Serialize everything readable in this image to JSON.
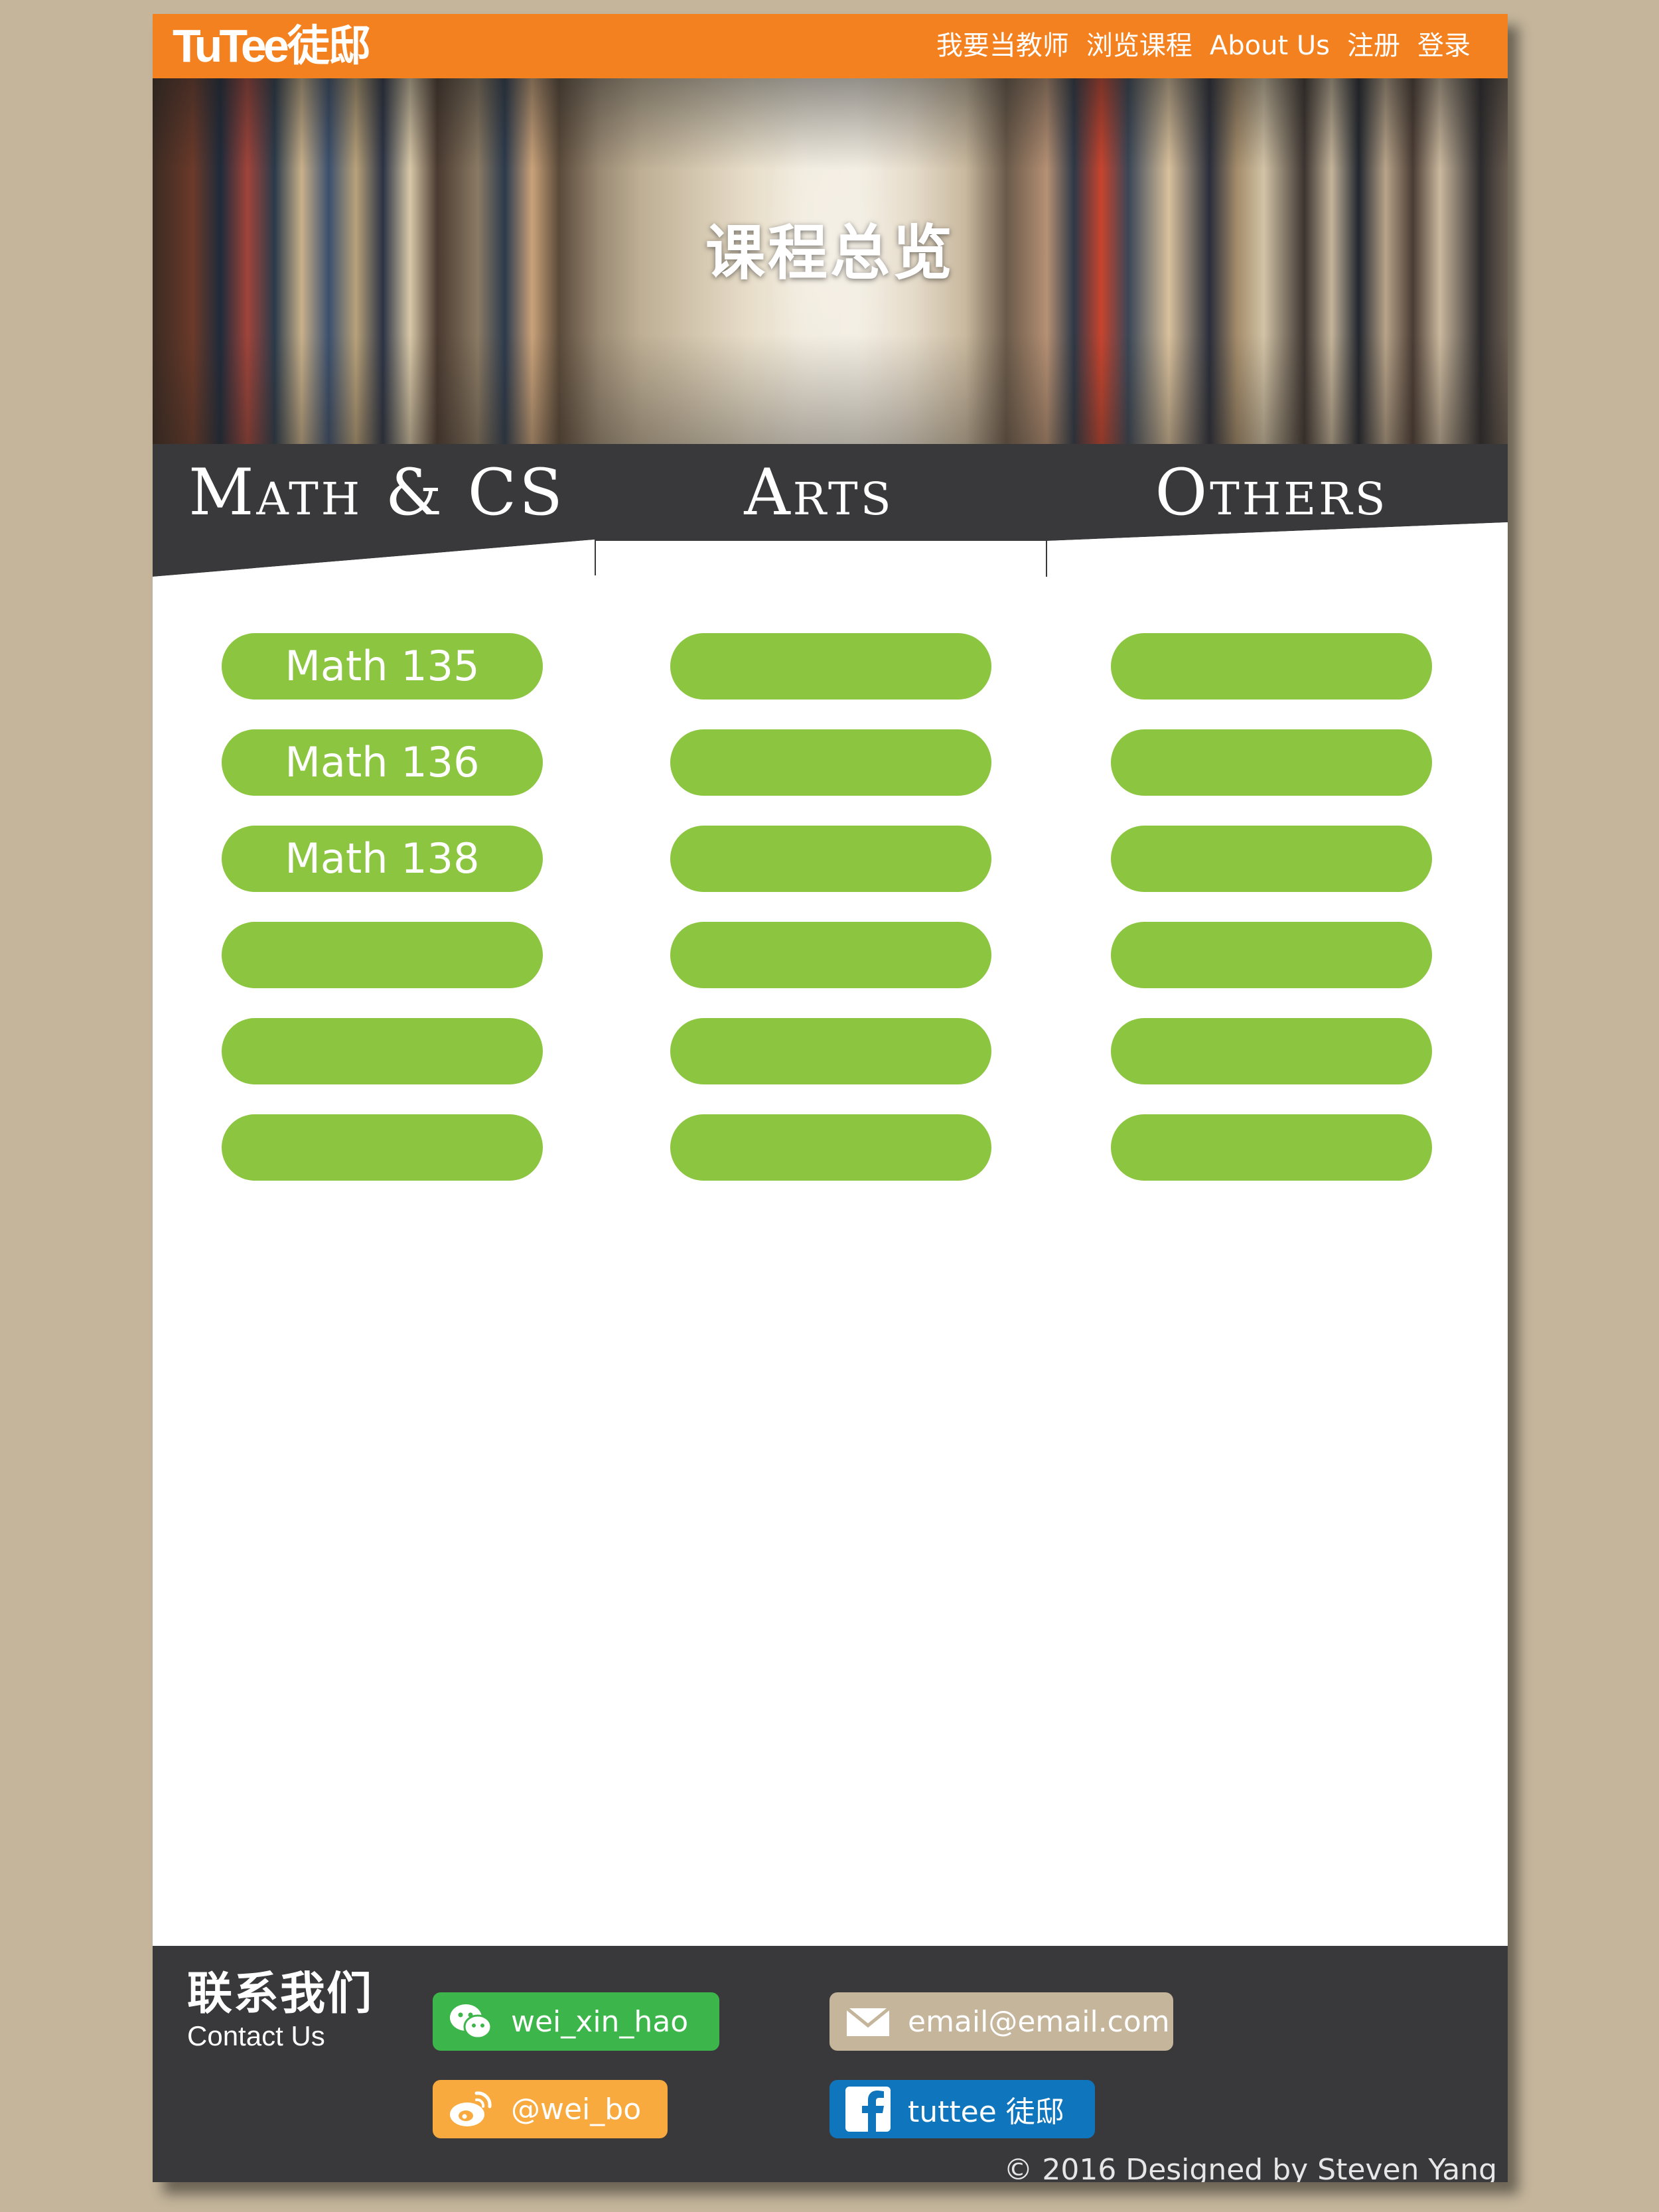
{
  "header": {
    "logo_latin": "TuTee",
    "logo_cn": "徒邸",
    "nav": [
      "我要当教师",
      "浏览课程",
      "About Us",
      "注册",
      "登录"
    ]
  },
  "hero": {
    "title": "课程总览"
  },
  "categories": [
    "Math & CS",
    "Arts",
    "Others"
  ],
  "columns": [
    [
      "Math 135",
      "Math 136",
      "Math 138",
      "",
      "",
      ""
    ],
    [
      "",
      "",
      "",
      "",
      "",
      ""
    ],
    [
      "",
      "",
      "",
      "",
      "",
      ""
    ]
  ],
  "footer": {
    "contact_cn": "联系我们",
    "contact_en": "Contact Us",
    "wechat": "wei_xin_hao",
    "email": "email@email.com",
    "weibo": "@wei_bo",
    "facebook": "tuttee 徒邸",
    "copyright": "© 2016 Designed by Steven Yang"
  },
  "colors": {
    "accent": "#f48120",
    "pill": "#8cc53f",
    "dark": "#39393b",
    "background": "#c4b59b",
    "wechat": "#3cb54a",
    "email": "#c4b59b",
    "weibo": "#f9aa3e",
    "facebook": "#0f75bd"
  },
  "icons": [
    "wechat-icon",
    "email-icon",
    "weibo-icon",
    "facebook-icon"
  ]
}
